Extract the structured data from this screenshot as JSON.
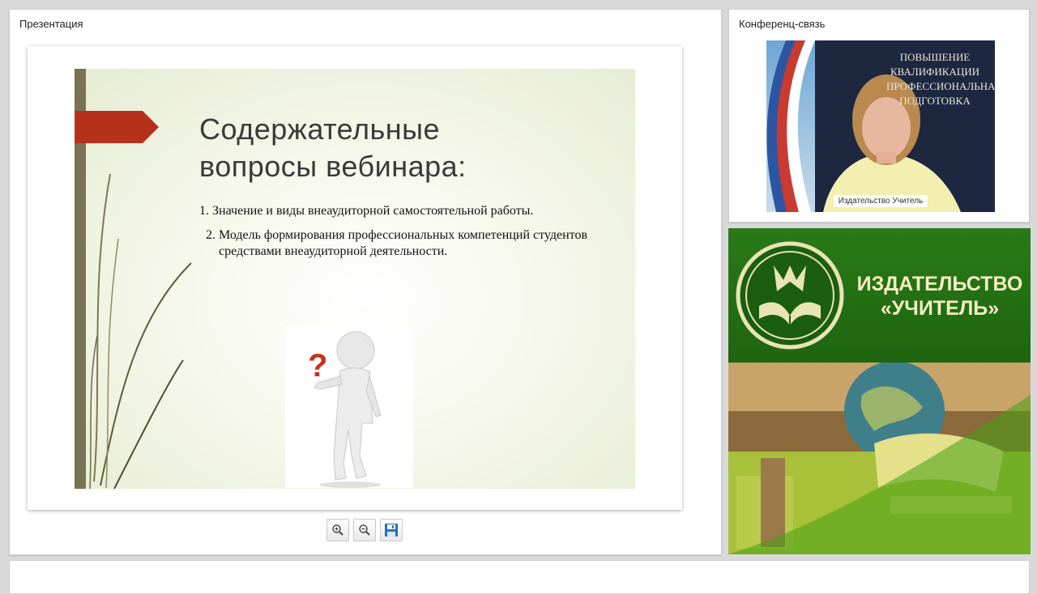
{
  "presentation": {
    "panel_title": "Презентация",
    "slide": {
      "title_line1": "Содержательные",
      "title_line2": "вопросы вебинара:",
      "items": [
        "1. Значение и виды внеаудиторной самостоятельной работы.",
        "2. Модель формирования профессиональных компетенций студентов средствами внеаудиторной деятельности."
      ],
      "accent_color": "#b5311b",
      "bar_color": "#7a7255"
    },
    "toolbar": {
      "zoom_in_icon": "zoom-in-icon",
      "zoom_out_icon": "zoom-out-icon",
      "save_icon": "floppy-disk-icon"
    }
  },
  "conference": {
    "panel_title": "Конференц-связь",
    "video_caption": "Издательство Учитель",
    "backdrop_text_line1": "Повышение",
    "backdrop_text_line2": "квалификации",
    "backdrop_text_line3": "профессиональная",
    "backdrop_text_line4": "подготовка"
  },
  "banner": {
    "line1": "ИЗДАТЕЛЬСТВО",
    "line2": "«УЧИТЕЛЬ»",
    "brand_color": "#1e6510",
    "text_color": "#f4efc4"
  }
}
